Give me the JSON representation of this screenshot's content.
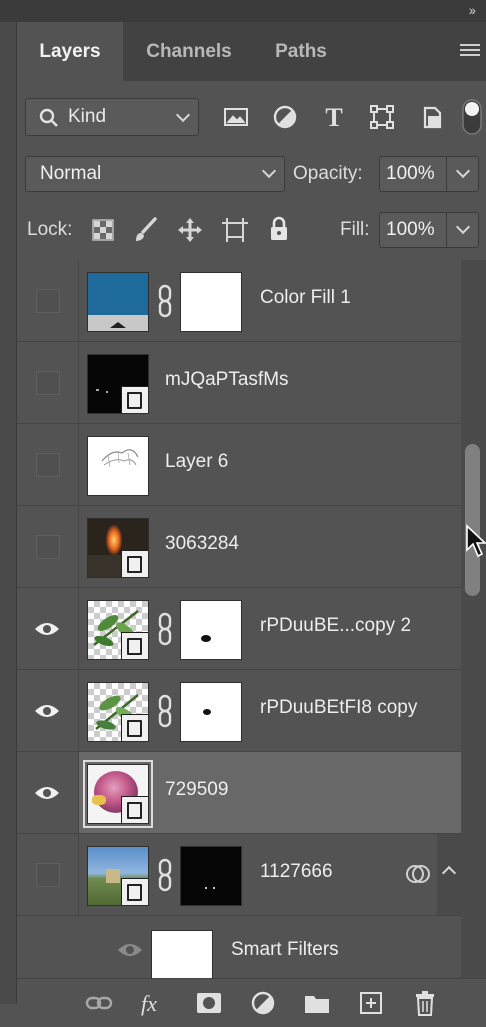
{
  "tabs": [
    {
      "label": "Layers",
      "active": true
    },
    {
      "label": "Channels",
      "active": false
    },
    {
      "label": "Paths",
      "active": false
    }
  ],
  "filter": {
    "kind_label": "Kind",
    "icons": [
      "pixel-layer-filter-icon",
      "adjustment-layer-filter-icon",
      "type-layer-filter-icon",
      "shape-layer-filter-icon",
      "smart-object-filter-icon",
      "filter-toggle-icon"
    ]
  },
  "blend": {
    "mode": "Normal",
    "opacity_label": "Opacity:",
    "opacity_value": "100%"
  },
  "lock": {
    "label": "Lock:",
    "icons": [
      "lock-transparent-pixels-icon",
      "lock-image-pixels-icon",
      "lock-position-icon",
      "lock-artboard-icon",
      "lock-all-icon"
    ],
    "fill_label": "Fill:",
    "fill_value": "100%"
  },
  "layers": [
    {
      "name": "Color Fill 1",
      "visible": false,
      "has_mask": true,
      "selected": false,
      "thumb": "color-fill"
    },
    {
      "name": "mJQaPTasfMs",
      "visible": false,
      "has_mask": false,
      "selected": false,
      "thumb": "dark"
    },
    {
      "name": "Layer 6",
      "visible": false,
      "has_mask": false,
      "selected": false,
      "thumb": "sketch"
    },
    {
      "name": "3063284",
      "visible": false,
      "has_mask": false,
      "selected": false,
      "thumb": "fire"
    },
    {
      "name": "rPDuuBE...copy 2",
      "visible": true,
      "has_mask": true,
      "selected": false,
      "thumb": "leaves"
    },
    {
      "name": "rPDuuBEtFI8 copy",
      "visible": true,
      "has_mask": true,
      "selected": false,
      "thumb": "leaves"
    },
    {
      "name": "729509",
      "visible": true,
      "has_mask": false,
      "selected": true,
      "thumb": "rose"
    },
    {
      "name": "1127666",
      "visible": false,
      "has_mask": true,
      "selected": false,
      "thumb": "landscape"
    }
  ],
  "smart_filters": {
    "label": "Smart Filters"
  },
  "colors": {
    "accent_fill": "#1e6a9a",
    "panel_bg": "#535353",
    "selected_row": "#686868"
  },
  "bottom_icons": [
    "link-layers-icon",
    "layer-effects-icon",
    "add-mask-icon",
    "new-adjustment-layer-icon",
    "new-group-icon",
    "new-layer-icon",
    "delete-layer-icon"
  ],
  "bottom_labels": {
    "fx": "fx"
  }
}
